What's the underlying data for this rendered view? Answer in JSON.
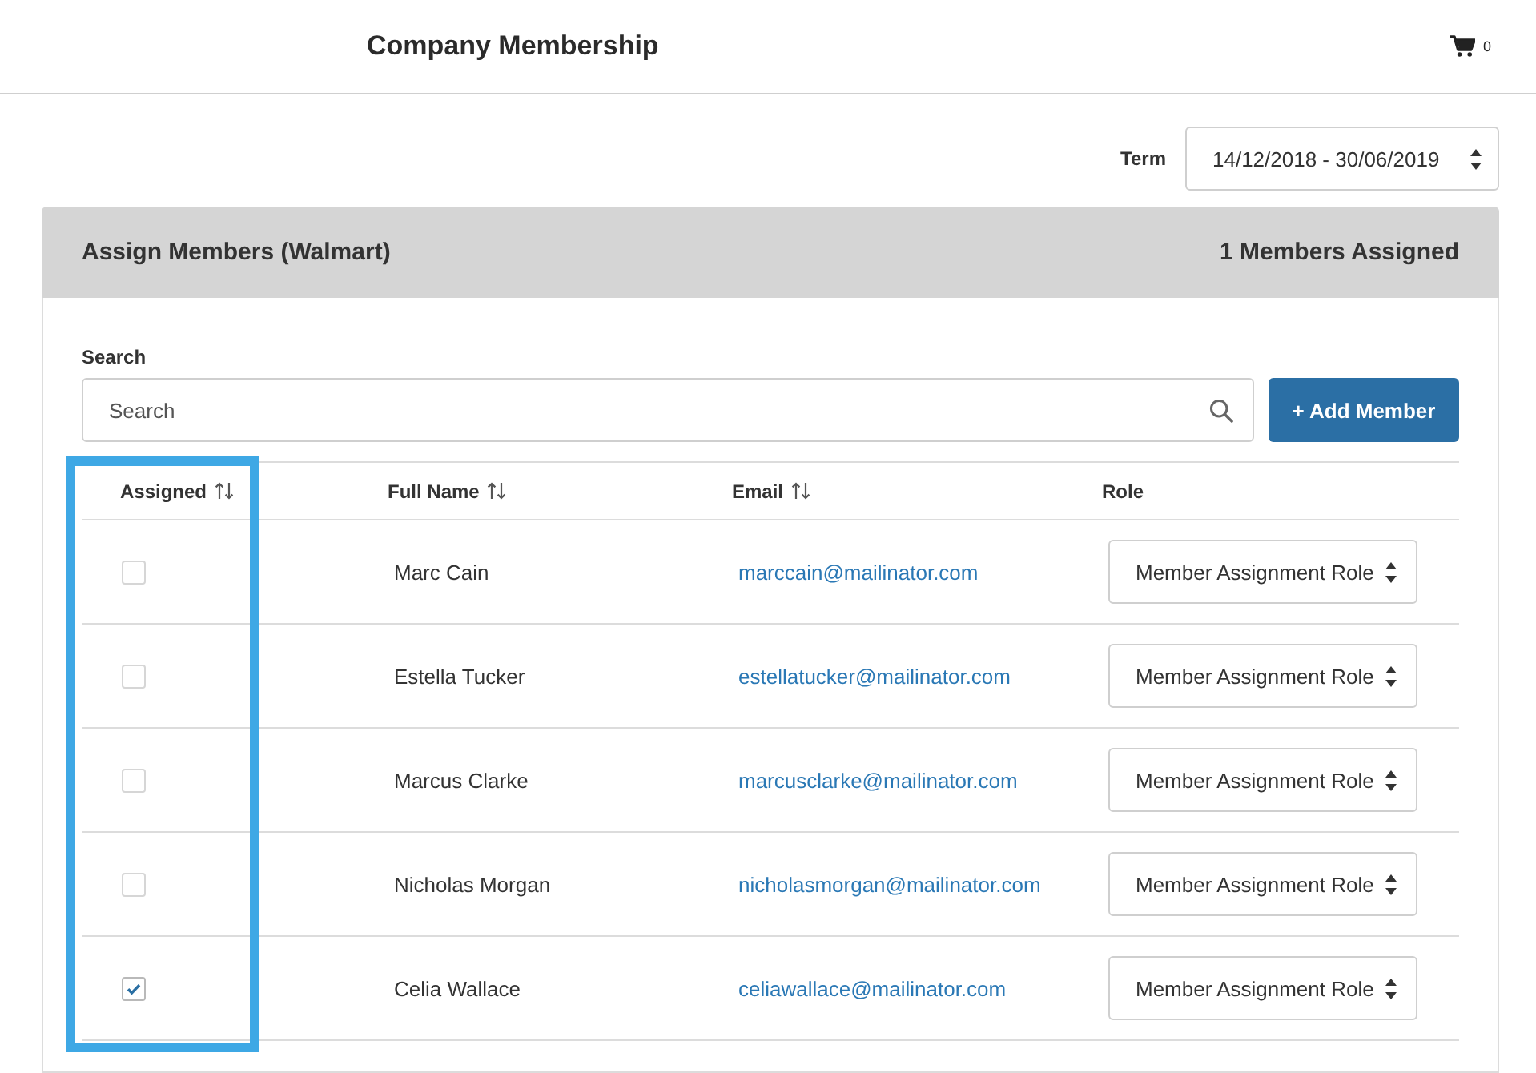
{
  "header": {
    "title": "Company Membership",
    "cart_count": "0"
  },
  "term": {
    "label": "Term",
    "value": "14/12/2018 - 30/06/2019"
  },
  "panel": {
    "title": "Assign Members (Walmart)",
    "summary": "1 Members Assigned",
    "search": {
      "label": "Search",
      "placeholder": "Search"
    },
    "add_button": "+ Add Member",
    "table": {
      "columns": [
        {
          "label": "Assigned",
          "sortable": true,
          "highlighted": true
        },
        {
          "label": "Full Name",
          "sortable": true,
          "highlighted": false
        },
        {
          "label": "Email",
          "sortable": true,
          "highlighted": false
        },
        {
          "label": "Role",
          "sortable": false,
          "highlighted": false
        }
      ],
      "rows": [
        {
          "assigned": false,
          "full_name": "Marc Cain",
          "email": "marccain@mailinator.com",
          "role": "Member Assignment Role"
        },
        {
          "assigned": false,
          "full_name": "Estella Tucker",
          "email": "estellatucker@mailinator.com",
          "role": "Member Assignment Role"
        },
        {
          "assigned": false,
          "full_name": "Marcus Clarke",
          "email": "marcusclarke@mailinator.com",
          "role": "Member Assignment Role"
        },
        {
          "assigned": false,
          "full_name": "Nicholas Morgan",
          "email": "nicholasmorgan@mailinator.com",
          "role": "Member Assignment Role"
        },
        {
          "assigned": true,
          "full_name": "Celia Wallace",
          "email": "celiawallace@mailinator.com",
          "role": "Member Assignment Role"
        }
      ]
    }
  }
}
